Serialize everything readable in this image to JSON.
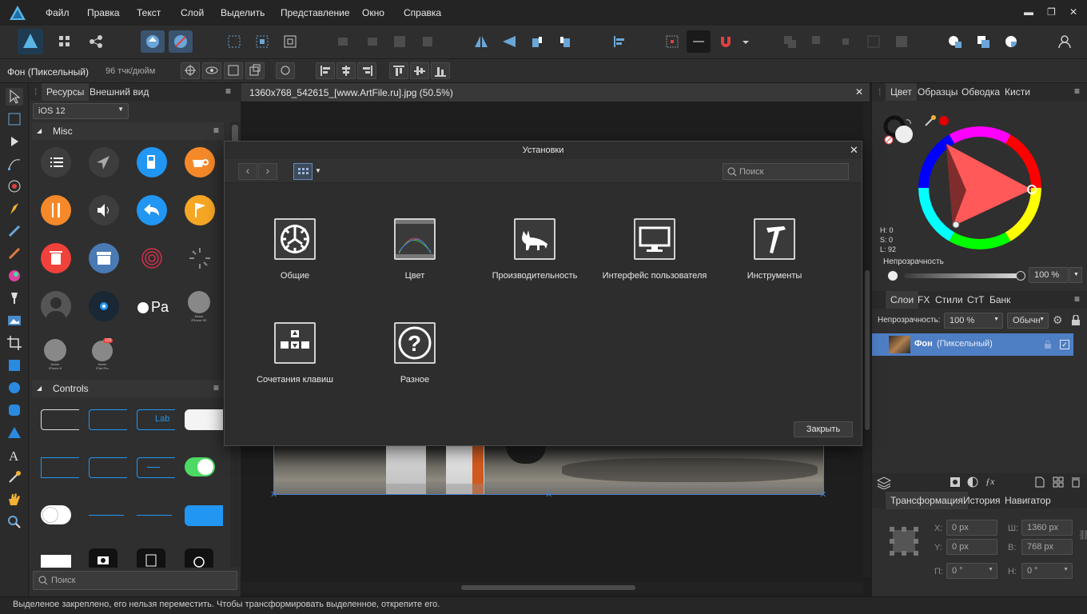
{
  "menu": [
    "Файл",
    "Правка",
    "Текст",
    "Слой",
    "Выделить",
    "Представление",
    "Окно",
    "Справка"
  ],
  "context": {
    "layer_name": "Фон (Пиксельный)",
    "dpi": "96 тчк/дюйм"
  },
  "assets": {
    "tabs": [
      "Ресурсы",
      "Внешний вид"
    ],
    "category": "iOS 12",
    "section_misc": "Misc",
    "section_controls": "Controls",
    "search_placeholder": "Поиск",
    "name_label": "Name",
    "iphone_se": "iPhone SE",
    "iphone_8": "iPhone 8",
    "ipad_pro": "iPad Pro",
    "badge": "123",
    "lab": "Lab",
    "colors": {
      "blue": "#2196f3",
      "orange": "#f5892a",
      "red": "#f0413a",
      "steel": "#4a7ab3"
    }
  },
  "document": {
    "tab_title": "1360x768_542615_[www.ArtFile.ru].jpg (50.5%)"
  },
  "dialog": {
    "title": "Установки",
    "search_placeholder": "Поиск",
    "items": [
      "Общие",
      "Цвет",
      "Производительность",
      "Интерфейс пользователя",
      "Инструменты",
      "Сочетания клавиш",
      "Разное"
    ],
    "close_button": "Закрыть"
  },
  "color_panel": {
    "tabs": [
      "Цвет",
      "Образцы",
      "Обводка",
      "Кисти"
    ],
    "h": "H: 0",
    "s": "S: 0",
    "l": "L: 92",
    "opacity_label": "Непрозрачность",
    "opacity_value": "100 %"
  },
  "layers_panel": {
    "tabs": [
      "Слои",
      "FX",
      "Стили",
      "СтТ",
      "Банк"
    ],
    "opacity_label": "Непрозрачность:",
    "opacity_value": "100 %",
    "blend_mode": "Обычн",
    "layer_name": "Фон",
    "layer_type": "(Пиксельный)"
  },
  "transform_panel": {
    "tabs": [
      "Трансформация",
      "История",
      "Навигатор"
    ],
    "x_label": "X:",
    "x": "0 px",
    "y_label": "Y:",
    "y": "0 px",
    "w_label": "Ш:",
    "w": "1360 px",
    "h_label": "В:",
    "h": "768 px",
    "r_label": "П:",
    "r": "0 °",
    "s_label": "Н:",
    "s": "0 °"
  },
  "status": "Выделеное закреплено, его нельзя переместить. Чтобы трансформировать выделенное, открепите его."
}
